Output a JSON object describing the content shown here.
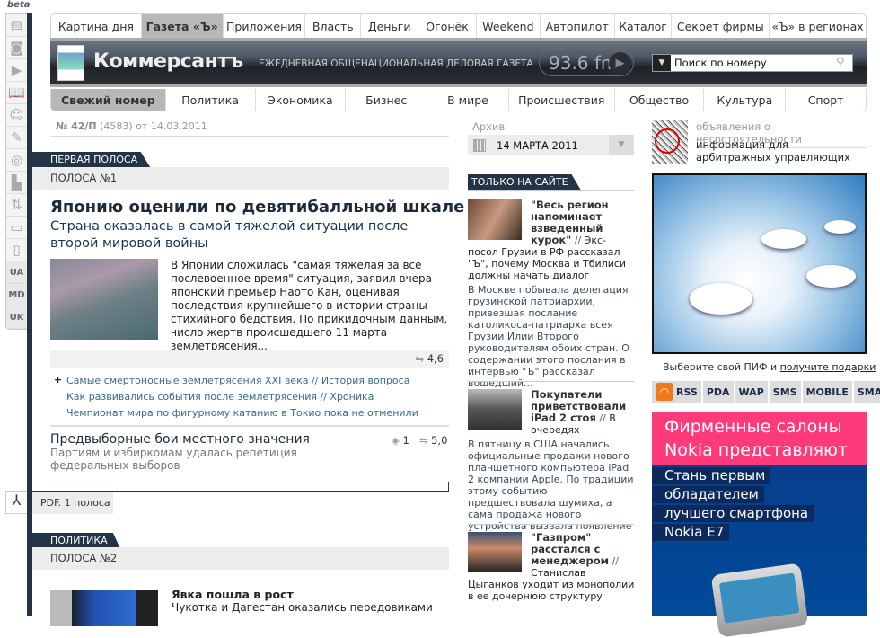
{
  "beta": "beta",
  "sidebar_icons": [
    "page-icon",
    "camera-icon",
    "play-icon",
    "book-icon",
    "user-icon",
    "pencil-icon",
    "target-icon",
    "document-icon",
    "arrows-icon",
    "comment-icon",
    "folder-icon"
  ],
  "sidebar_langs": [
    "UA",
    "MD",
    "UK"
  ],
  "top_tabs": [
    "Картина дня",
    "Газета «Ъ»",
    "Приложения",
    "Власть",
    "Деньги",
    "Огонёк",
    "Weekend",
    "Автопилот",
    "Каталог",
    "Секрет фирмы",
    "«Ъ» в регионах"
  ],
  "header": {
    "logo": "Коммерсантъ",
    "tagline": "ЕЖЕДНЕВНАЯ ОБЩЕНАЦИОНАЛЬНАЯ ДЕЛОВАЯ ГАЗЕТА",
    "radio": "93.6 fm",
    "search_value": "Поиск по номеру"
  },
  "section_nav": [
    "Свежий номер",
    "Политика",
    "Экономика",
    "Бизнес",
    "В мире",
    "Происшествия",
    "Общество",
    "Культура",
    "Спорт"
  ],
  "issue": {
    "number": "№ 42/П",
    "code": "(4583)",
    "date": "от 14.03.2011"
  },
  "first": {
    "section": "ПЕРВАЯ ПОЛОСА",
    "band": "ПОЛОСА №1",
    "headline": "Японию оценили по девятибалльной шкале",
    "subhead": "Страна оказалась в самой тяжелой ситуации после второй мировой войны",
    "text": "В Японии сложилась \"самая тяжелая за все послевоенное время\" ситуация, заявил вчера японский премьер Наото Кан, оценивая последствия крупнейшего в истории страны стихийного бедствия. По прикидочным данным, число жертв происшедшего 11 марта землетрясения...",
    "rating": "4,6",
    "links": [
      "Самые смертоносные землетрясения XXI века // История вопроса",
      "Как развивались события после землетрясения // Хроника",
      "Чемпионат мира по фигурному катанию в Токио пока не отменили"
    ],
    "second_headline": "Предвыборные бои местного значения",
    "second_sub": "Партиям и избиркомам удалась репетиция федеральных выборов",
    "second_comments": "1",
    "second_rating": "5,0",
    "pdf": "PDF. 1 полоса"
  },
  "politics": {
    "section": "ПОЛИТИКА",
    "band": "ПОЛОСА №2",
    "headline": "Явка пошла в рост",
    "subhead": "Чукотка и Дагестан оказались передовиками"
  },
  "archive": {
    "label": "Архив",
    "date": "14 МАРТА 2011"
  },
  "only_site": {
    "label": "ТОЛЬКО НА САЙТЕ",
    "items": [
      {
        "title": "\"Весь регион напоминает взведенный курок\"",
        "sub": "Экс-посол Грузии в РФ рассказал \"Ъ\", почему Москва и Тбилиси должны начать диалог",
        "text": "В Москве побывала делегация грузинской патриархии, привезшая послание католикоса-патриарха всея Грузии Илии Второго руководителям обоих стран. О содержании этого послания в интервью \"Ъ\" рассказал вошедший..."
      },
      {
        "title": "Покупатели приветствовали iPad 2 стоя",
        "sub": "В очередях",
        "text": "В пятницу в США начались официальные продажи нового планшетного компьютера iPad 2 компании Apple. По традиции этому событию предшествовала шумиха, а сама продажа нового устройства вызвала появление на..."
      },
      {
        "title": "\"Газпром\" расстался с менеджером",
        "sub": "Станислав Цыганков уходит из монополии в ее дочернюю структуру",
        "text": ""
      }
    ]
  },
  "insolvency": {
    "title": "объявления о несостоятельности",
    "text": "информация для арбитражных управляющих"
  },
  "ad_caption": {
    "text": "Выберите свой ПИФ и ",
    "link": "получите подарки"
  },
  "feeds": [
    "RSS",
    "PDA",
    "WAP",
    "SMS",
    "MOBILE",
    "SMART"
  ],
  "nokia": {
    "top": "Фирменные салоны Nokia представляют",
    "lines": [
      "Стань первым",
      "обладателем",
      "лучшего смартфона",
      "Nokia E7"
    ]
  },
  "colors": {
    "dark": "#243447",
    "pink": "#ff3a7a",
    "nokia_blue": "#004a9a"
  }
}
